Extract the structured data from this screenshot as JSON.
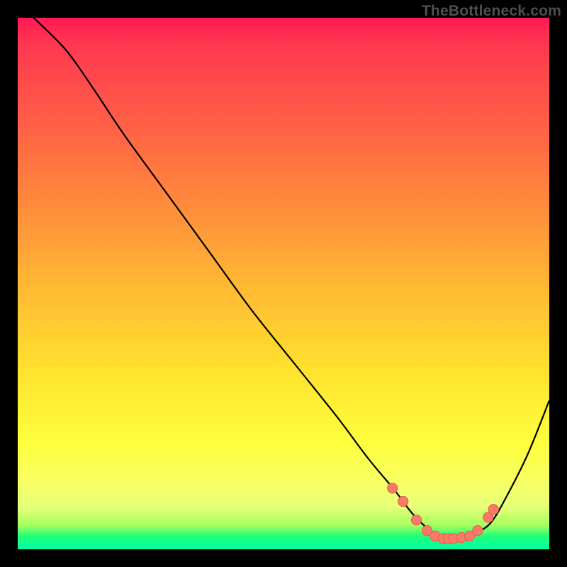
{
  "watermark": "TheBottleneck.com",
  "colors": {
    "background": "#000000",
    "gradient_stops": [
      {
        "pos": 0.0,
        "hex": "#ff1a52"
      },
      {
        "pos": 0.05,
        "hex": "#ff3850"
      },
      {
        "pos": 0.18,
        "hex": "#ff5a48"
      },
      {
        "pos": 0.35,
        "hex": "#ff8a3c"
      },
      {
        "pos": 0.5,
        "hex": "#ffb734"
      },
      {
        "pos": 0.66,
        "hex": "#ffe12e"
      },
      {
        "pos": 0.8,
        "hex": "#feff3d"
      },
      {
        "pos": 0.88,
        "hex": "#f6ff66"
      },
      {
        "pos": 0.92,
        "hex": "#e6ff7a"
      },
      {
        "pos": 0.955,
        "hex": "#a6ff5f"
      },
      {
        "pos": 0.975,
        "hex": "#22ff77"
      },
      {
        "pos": 1.0,
        "hex": "#00ffa8"
      }
    ],
    "curve_stroke": "#000000",
    "marker_fill": "#fa7a6a",
    "marker_stroke": "#e85c4a"
  },
  "chart_data": {
    "type": "line",
    "title": "",
    "xlabel": "",
    "ylabel": "",
    "xlim": [
      0,
      100
    ],
    "ylim": [
      0,
      100
    ],
    "note": "x/y are percent of plot width/height measured from top-left; the curve forms a V/U shape with minimum near x≈80, y≈98. Axis values are not labeled in the source image, so coordinates are geometric positions.",
    "series": [
      {
        "name": "curve",
        "x": [
          0,
          3,
          9,
          14,
          20,
          28,
          36,
          44,
          52,
          60,
          66,
          71,
          74,
          77,
          80,
          83,
          86,
          89,
          92,
          96,
          100
        ],
        "y": [
          -3,
          0,
          6,
          13,
          22,
          33,
          44,
          55,
          65,
          75,
          83,
          89,
          93,
          96,
          98,
          98,
          97,
          95,
          90,
          82,
          72
        ]
      }
    ],
    "markers": {
      "name": "highlighted-points",
      "x": [
        70.5,
        72.5,
        75.0,
        77.0,
        78.5,
        80.0,
        81.0,
        82.0,
        83.5,
        85.0,
        86.5,
        88.5,
        89.5
      ],
      "y": [
        88.5,
        91.0,
        94.5,
        96.5,
        97.5,
        98.0,
        98.0,
        98.0,
        97.8,
        97.5,
        96.5,
        94.0,
        92.5
      ]
    }
  }
}
